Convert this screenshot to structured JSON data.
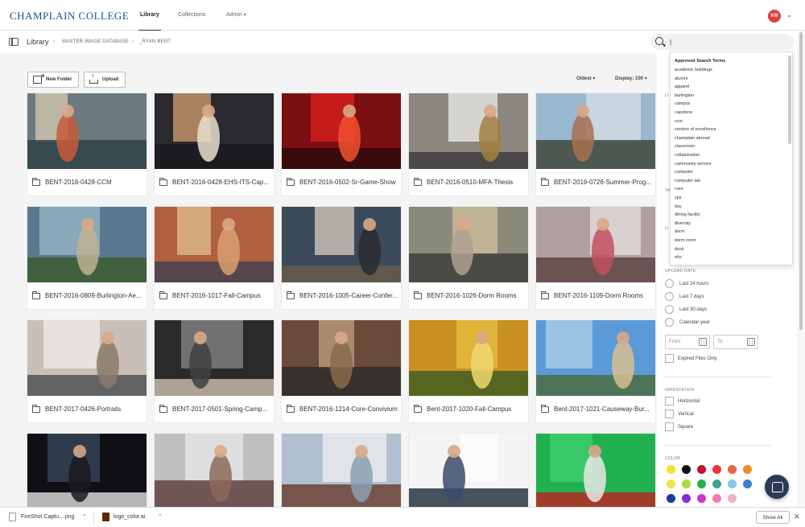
{
  "app": {
    "logo": "CHAMPLAIN COLLEGE",
    "nav": [
      {
        "label": "Library",
        "active": true
      },
      {
        "label": "Collections",
        "active": false
      },
      {
        "label": "Admin",
        "active": false
      }
    ],
    "user_initials": "KM",
    "accent": "#e33b3b"
  },
  "breadcrumb": {
    "root": "Library",
    "items": [
      "MASTER IMAGE DATABASE",
      "_RYAN BENT"
    ]
  },
  "search": {
    "value": "|",
    "placeholder": ""
  },
  "toolbar": {
    "new_folder": "New Folder",
    "upload": "Upload",
    "sort": "Oldest",
    "display": "Display: 100",
    "pager_prev": "‹"
  },
  "folders": [
    "BENT-2016-0428-CCM",
    "BENT-2016-0428-EHS-ITS-Cap...",
    "BENT-2016-0502-Sr-Game-Show",
    "BENT-2016-0510-MFA-Thesis",
    "BENT-2016-0726-Summer-Prog...",
    "BENT-2016-0809-Burlington-Ae...",
    "BENT-2016-1017-Fall-Campus",
    "BENT-2016-1005-Career-Confer...",
    "BENT-2016-1026-Dorm Rooms",
    "BENT-2016-1109-Dorm Rooms",
    "BENT-2017-0426-Portraits",
    "BENT-2017-0501-Spring-Camp...",
    "BENT-2016-1214-Core-Convivium",
    "Bent-2017-1020-Fall-Campus",
    "Bent-2017-1021-Causeway-Bur...",
    "",
    "",
    "",
    "",
    ""
  ],
  "suggestions": {
    "heading": "Approved Search Terms",
    "terms": [
      "academic buildings",
      "alumni",
      "apparel",
      "burlington",
      "campus",
      "capstone",
      "ccm",
      "centers of excellence",
      "champlain abroad",
      "classroom",
      "collaboration",
      "community service",
      "computer",
      "computer lab",
      "core",
      "cps",
      "day",
      "dining facility",
      "diversity",
      "dorm",
      "dorm room",
      "dusk",
      "ehs"
    ]
  },
  "filters": {
    "upload_date": {
      "heading": "UPLOAD DATE",
      "options": [
        "Last 24 hours",
        "Last 7 days",
        "Last 30 days",
        "Calendar year"
      ]
    },
    "from_label": "From",
    "to_label": "To",
    "expired": "Expired Files Only",
    "orientation": {
      "heading": "ORIENTATION",
      "options": [
        "Horizontal",
        "Vertical",
        "Square"
      ]
    },
    "color": {
      "heading": "COLOR",
      "swatches": [
        "#f5e52a",
        "#111111",
        "#c8102e",
        "#e8323c",
        "#e8664a",
        "#f08a2a",
        "#f2e04a",
        "#a6dd3a",
        "#27b04a",
        "#3aa58a",
        "#86c7e8",
        "#3a7ec8",
        "#1a3c9a",
        "#8a2ad8",
        "#c83ac8",
        "#f07ab4",
        "#f0b0c8"
      ]
    },
    "partial_labels": [
      "LI",
      "TA",
      "LI"
    ]
  },
  "downloads": {
    "items": [
      "FireShot Captu....png",
      "logo_color.ai"
    ],
    "show_all": "Show All"
  }
}
